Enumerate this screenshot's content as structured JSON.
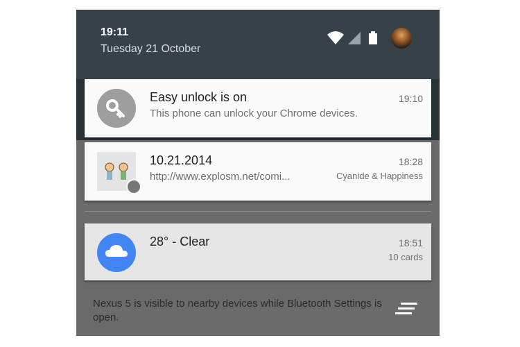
{
  "status_bar": {
    "time": "19:11",
    "date": "Tuesday 21 October"
  },
  "notifications": [
    {
      "icon": "key-icon",
      "title": "Easy unlock is on",
      "text": "This phone can unlock your Chrome devices.",
      "time": "19:10"
    },
    {
      "icon": "comic-thumbnail",
      "title": "10.21.2014",
      "text": "http://www.explosm.net/comi...",
      "time": "18:28",
      "app": "Cyanide & Happiness"
    },
    {
      "icon": "cloud-icon",
      "title": "28° - Clear",
      "time": "18:51",
      "info": "10 cards"
    }
  ],
  "bluetooth_message": "Nexus 5 is visible to nearby devices while Bluetooth Settings is open.",
  "colors": {
    "status_bar": "#37414a",
    "shade": "#6b6b6b",
    "weather_accent": "#4285f4",
    "key_circle": "#9e9e9e"
  }
}
